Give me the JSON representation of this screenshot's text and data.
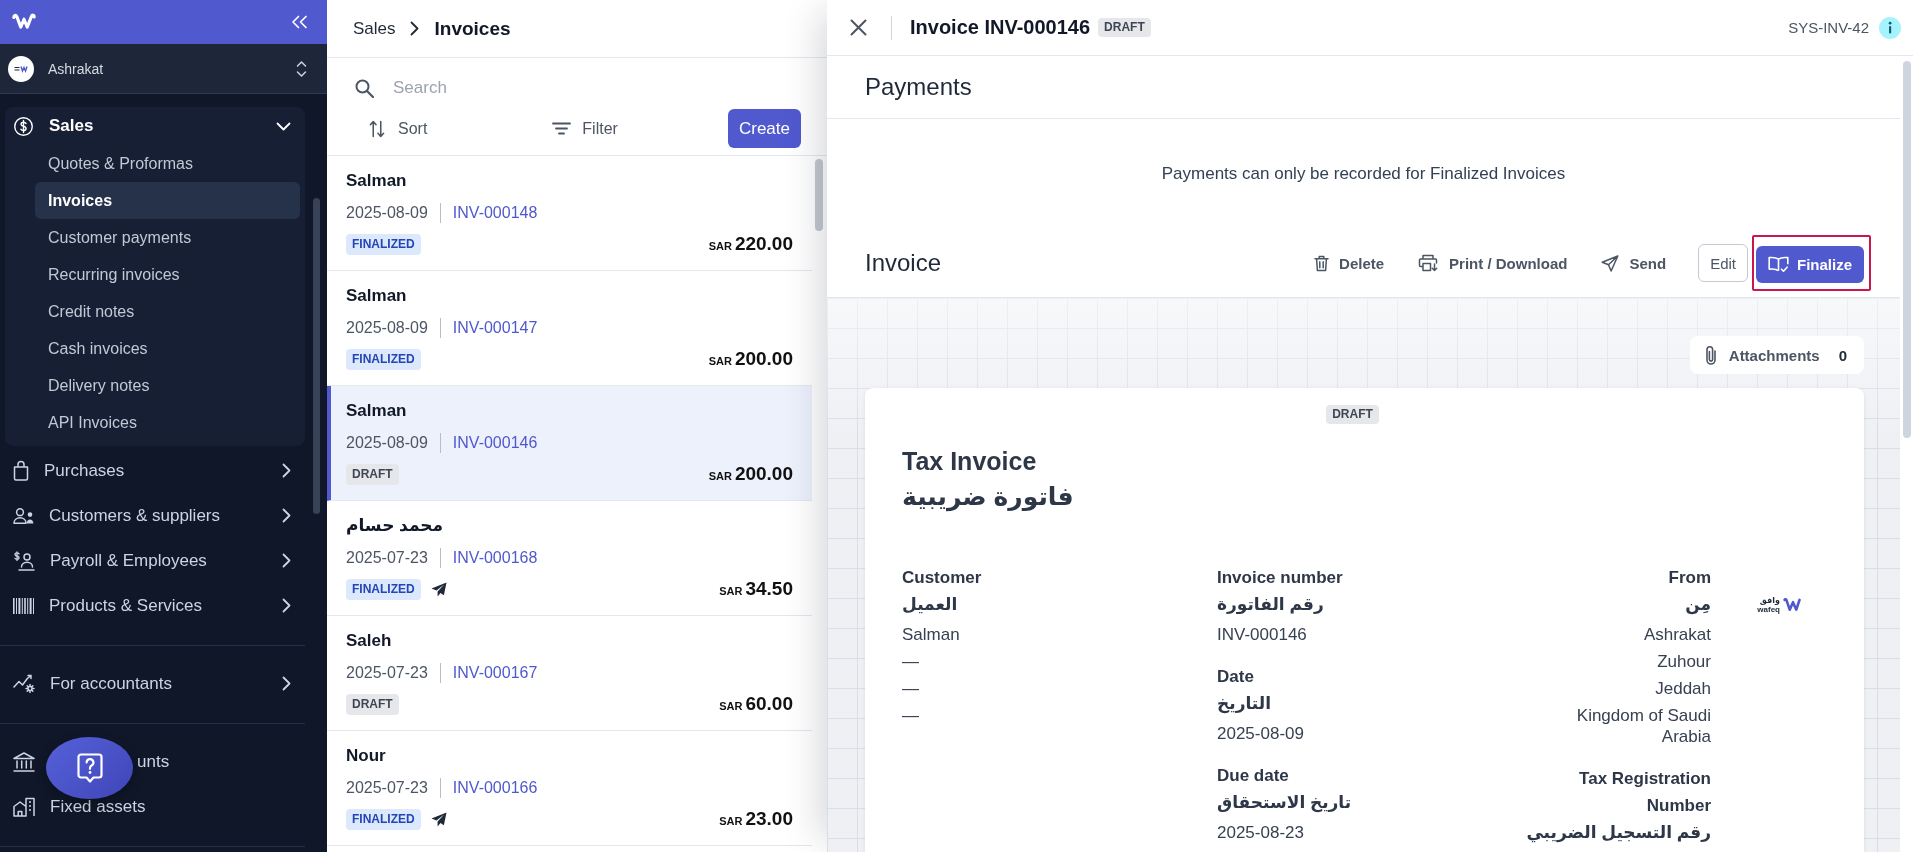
{
  "sidebar": {
    "org": {
      "name": "Ashrakat"
    },
    "sections": [
      {
        "items": [
          {
            "label": "Sales",
            "kind": "group",
            "expanded": true,
            "children": [
              {
                "label": "Quotes & Proformas",
                "selected": false
              },
              {
                "label": "Invoices",
                "selected": true
              },
              {
                "label": "Customer payments",
                "selected": false
              },
              {
                "label": "Recurring invoices",
                "selected": false
              },
              {
                "label": "Credit notes",
                "selected": false
              },
              {
                "label": "Cash invoices",
                "selected": false
              },
              {
                "label": "Delivery notes",
                "selected": false
              },
              {
                "label": "API Invoices",
                "selected": false
              }
            ]
          },
          {
            "label": "Purchases",
            "kind": "group",
            "expanded": false
          },
          {
            "label": "Customers & suppliers",
            "kind": "group",
            "expanded": false
          },
          {
            "label": "Payroll & Employees",
            "kind": "group",
            "expanded": false
          },
          {
            "label": "Products & Services",
            "kind": "group",
            "expanded": false
          }
        ]
      },
      {
        "items": [
          {
            "label": "For accountants",
            "kind": "group",
            "expanded": false
          }
        ]
      },
      {
        "items": [
          {
            "label": "unts",
            "kind": "link"
          },
          {
            "label": "Fixed assets",
            "kind": "link"
          }
        ]
      }
    ]
  },
  "list": {
    "breadcrumb": {
      "parent": "Sales",
      "current": "Invoices"
    },
    "search": {
      "placeholder": "Search"
    },
    "sort": "Sort",
    "filter": "Filter",
    "create": "Create",
    "rows": [
      {
        "name": "Salman",
        "date": "2025-08-09",
        "number": "INV-000148",
        "status": {
          "label": "FINALIZED",
          "kind": "finalized"
        },
        "sent": false,
        "currency": "SAR",
        "amount": "220.00",
        "selected": false
      },
      {
        "name": "Salman",
        "date": "2025-08-09",
        "number": "INV-000147",
        "status": {
          "label": "FINALIZED",
          "kind": "finalized"
        },
        "sent": false,
        "currency": "SAR",
        "amount": "200.00",
        "selected": false
      },
      {
        "name": "Salman",
        "date": "2025-08-09",
        "number": "INV-000146",
        "status": {
          "label": "DRAFT",
          "kind": "draft"
        },
        "sent": false,
        "currency": "SAR",
        "amount": "200.00",
        "selected": true
      },
      {
        "name": "محمد حسام",
        "date": "2025-07-23",
        "number": "INV-000168",
        "status": {
          "label": "FINALIZED",
          "kind": "finalized"
        },
        "sent": true,
        "currency": "SAR",
        "amount": "34.50",
        "selected": false
      },
      {
        "name": "Saleh",
        "date": "2025-07-23",
        "number": "INV-000167",
        "status": {
          "label": "DRAFT",
          "kind": "draft"
        },
        "sent": false,
        "currency": "SAR",
        "amount": "60.00",
        "selected": false
      },
      {
        "name": "Nour",
        "date": "2025-07-23",
        "number": "INV-000166",
        "status": {
          "label": "FINALIZED",
          "kind": "finalized"
        },
        "sent": true,
        "currency": "SAR",
        "amount": "23.00",
        "selected": false
      }
    ]
  },
  "detail": {
    "title": "Invoice INV-000146",
    "status": {
      "label": "DRAFT",
      "kind": "draft"
    },
    "system_id": "SYS-INV-42",
    "payments": {
      "title": "Payments",
      "message": "Payments can only be recorded for Finalized Invoices"
    },
    "invoice": {
      "title": "Invoice",
      "actions": [
        {
          "label": "Delete",
          "kind": "text",
          "highlighted": false
        },
        {
          "label": "Print / Download",
          "kind": "text",
          "highlighted": false
        },
        {
          "label": "Send",
          "kind": "text",
          "highlighted": false
        },
        {
          "label": "Edit",
          "kind": "outline",
          "highlighted": false
        },
        {
          "label": "Finalize",
          "kind": "primary",
          "highlighted": true
        }
      ]
    },
    "attachments": {
      "label": "Attachments",
      "count": "0"
    },
    "document": {
      "status": {
        "label": "DRAFT",
        "kind": "draft"
      },
      "title": "Tax Invoice",
      "title_ar": "فاتورة ضريبية",
      "logo": {
        "text_ar": "وافق",
        "text": "wafeq"
      },
      "columns": [
        {
          "blocks": [
            {
              "label": "Customer",
              "label_ar": "العميل",
              "lines": [
                "Salman",
                "—",
                "—",
                "—"
              ]
            }
          ]
        },
        {
          "blocks": [
            {
              "label": "Invoice number",
              "label_ar": "رقم الفاتورة",
              "lines": [
                "INV-000146"
              ]
            },
            {
              "label": "Date",
              "label_ar": "التاريخ",
              "lines": [
                "2025-08-09"
              ]
            },
            {
              "label": "Due date",
              "label_ar": "تاريخ الاستحقاق",
              "lines": [
                "2025-08-23"
              ]
            }
          ]
        },
        {
          "blocks": [
            {
              "label": "From",
              "label_ar": "مِن",
              "lines": [
                "Ashrakat",
                "Zuhour",
                "Jeddah",
                "Kingdom of Saudi Arabia"
              ]
            },
            {
              "label": "Tax Registration Number",
              "label_ar": "رقم التسجيل الضريبي"
            }
          ]
        }
      ]
    }
  }
}
